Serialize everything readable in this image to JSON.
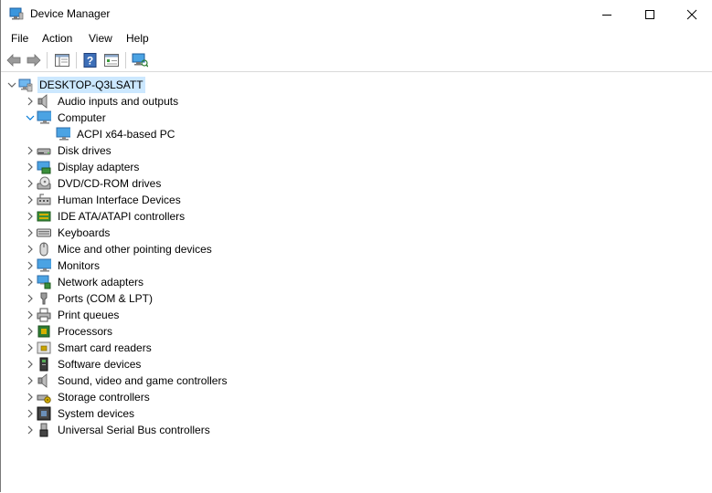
{
  "window": {
    "title": "Device Manager"
  },
  "menu": {
    "file": "File",
    "action": "Action",
    "view": "View",
    "help": "Help"
  },
  "tree": {
    "root": {
      "label": "DESKTOP-Q3LSATT",
      "icon": "computer-root-icon"
    },
    "categories": [
      {
        "label": "Audio inputs and outputs",
        "icon": "speaker-icon",
        "expanded": false
      },
      {
        "label": "Computer",
        "icon": "monitor-icon",
        "expanded": true
      },
      {
        "label": "ACPI x64-based PC",
        "icon": "monitor-icon",
        "child": true
      },
      {
        "label": "Disk drives",
        "icon": "disk-icon",
        "expanded": false
      },
      {
        "label": "Display adapters",
        "icon": "display-adapter-icon",
        "expanded": false
      },
      {
        "label": "DVD/CD-ROM drives",
        "icon": "dvd-icon",
        "expanded": false
      },
      {
        "label": "Human Interface Devices",
        "icon": "hid-icon",
        "expanded": false
      },
      {
        "label": "IDE ATA/ATAPI controllers",
        "icon": "ide-icon",
        "expanded": false
      },
      {
        "label": "Keyboards",
        "icon": "keyboard-icon",
        "expanded": false
      },
      {
        "label": "Mice and other pointing devices",
        "icon": "mouse-icon",
        "expanded": false
      },
      {
        "label": "Monitors",
        "icon": "monitor-icon",
        "expanded": false
      },
      {
        "label": "Network adapters",
        "icon": "network-icon",
        "expanded": false
      },
      {
        "label": "Ports (COM & LPT)",
        "icon": "port-icon",
        "expanded": false
      },
      {
        "label": "Print queues",
        "icon": "printer-icon",
        "expanded": false
      },
      {
        "label": "Processors",
        "icon": "processor-icon",
        "expanded": false
      },
      {
        "label": "Smart card readers",
        "icon": "smartcard-icon",
        "expanded": false
      },
      {
        "label": "Software devices",
        "icon": "software-device-icon",
        "expanded": false
      },
      {
        "label": "Sound, video and game controllers",
        "icon": "speaker-icon",
        "expanded": false
      },
      {
        "label": "Storage controllers",
        "icon": "storage-icon",
        "expanded": false
      },
      {
        "label": "System devices",
        "icon": "system-icon",
        "expanded": false
      },
      {
        "label": "Universal Serial Bus controllers",
        "icon": "usb-icon",
        "expanded": false
      }
    ]
  },
  "colors": {
    "selection": "#cce8ff",
    "accent": "#0078d7",
    "chevron": "#606060"
  }
}
